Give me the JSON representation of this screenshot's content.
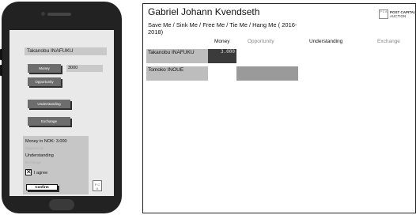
{
  "mobile": {
    "name_field": "Takanobu INAFUKU",
    "buttons": {
      "money": "Money",
      "opportunity": "Opportunity",
      "understanding": "Understanding",
      "exchange": "Exchange"
    },
    "money_value": "3000",
    "summary": {
      "money_line": "Money in NOK: 3.000",
      "opportunity_line": "Opportunity",
      "understanding_line": "Understanding",
      "exchange_line": "Exchange"
    },
    "checkbox_mark": "✕",
    "agree_label": "I agree",
    "confirm_label": "Confirm",
    "logo_text": "P C A"
  },
  "desktop": {
    "title": "Gabriel Johann Kvendseth",
    "subtitle": "Save Me / Sink Me / Free Me / Tie Me / Hang Me ( 2016-2018)",
    "columns": [
      "Money",
      "Opportunity",
      "Understanding",
      "Exchange"
    ],
    "rows": [
      {
        "name": "Takanobu INAFUKU",
        "money": "3.000"
      },
      {
        "name": "Tomoko INOUE"
      }
    ],
    "logo": {
      "box_text": "P C A",
      "text_line1": "POST CAPITAL",
      "text_line2": "AUCTION"
    }
  }
}
